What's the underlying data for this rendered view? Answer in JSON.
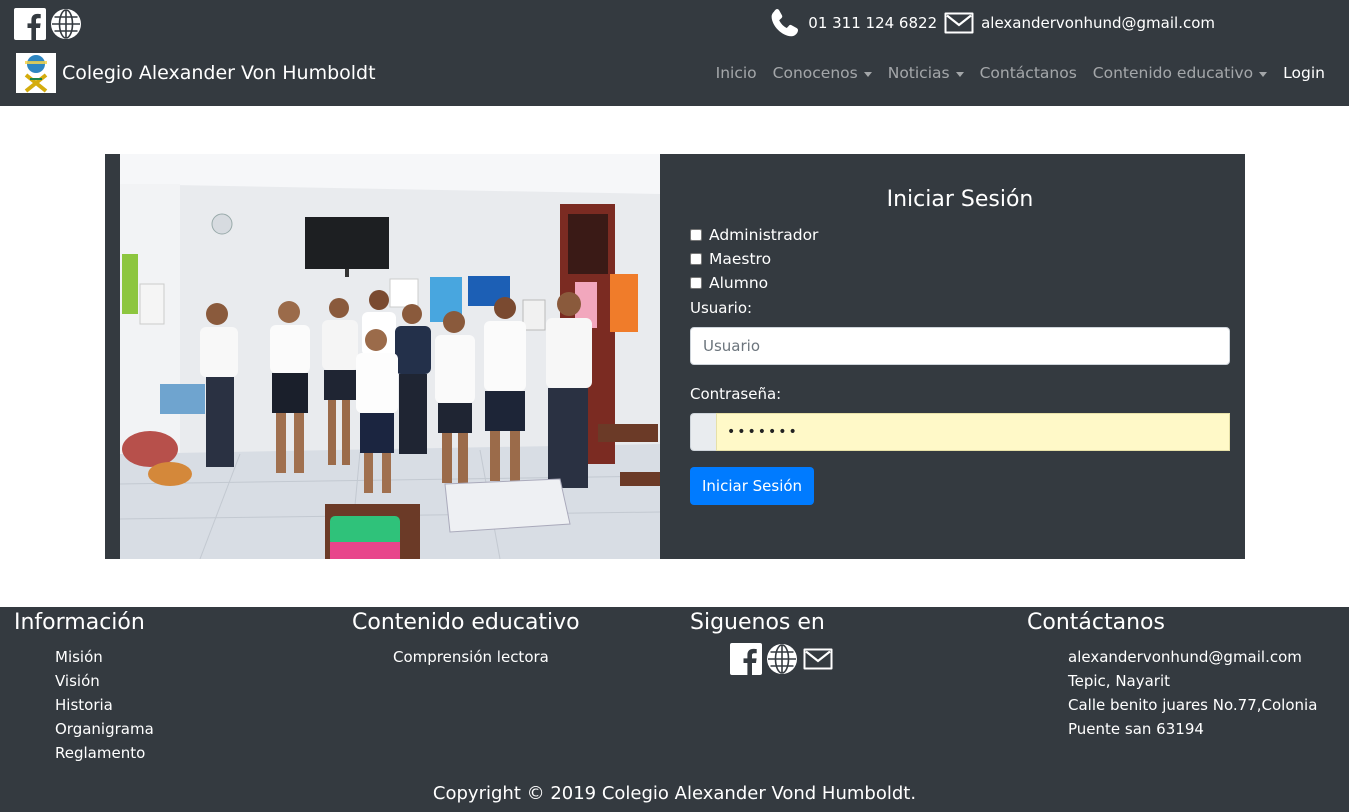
{
  "header": {
    "phone": "01 311 124 6822",
    "email": "alexandervonhund@gmail.com",
    "brand": "Colegio Alexander Von Humboldt",
    "nav": [
      {
        "label": "Inicio",
        "dropdown": false
      },
      {
        "label": "Conocenos",
        "dropdown": true
      },
      {
        "label": "Noticias",
        "dropdown": true
      },
      {
        "label": "Contáctanos",
        "dropdown": false
      },
      {
        "label": "Contenido educativo",
        "dropdown": true
      },
      {
        "label": "Login",
        "dropdown": false,
        "active": true
      }
    ]
  },
  "login": {
    "title": "Iniciar Sesión",
    "roles": [
      "Administrador",
      "Maestro",
      "Alumno"
    ],
    "user_label": "Usuario:",
    "user_placeholder": "Usuario",
    "password_label": "Contraseña:",
    "password_mask": "•••••••",
    "submit_label": "Iniciar Sesión"
  },
  "footer": {
    "info_title": "Información",
    "info_items": [
      "Misión",
      "Visión",
      "Historia",
      "Organigrama",
      "Reglamento"
    ],
    "edu_title": "Contenido educativo",
    "edu_items": [
      "Comprensión lectora"
    ],
    "social_title": "Siguenos en",
    "contact_title": "Contáctanos",
    "contact_items": [
      "alexandervonhund@gmail.com",
      "Tepic, Nayarit",
      "Calle benito juares No.77,Colonia",
      "Puente san 63194"
    ],
    "copyright": "Copyright © 2019 Colegio Alexander Vond Humboldt."
  },
  "colors": {
    "dark": "#343a40",
    "primary": "#007bff",
    "autofill": "#fff9c8"
  }
}
